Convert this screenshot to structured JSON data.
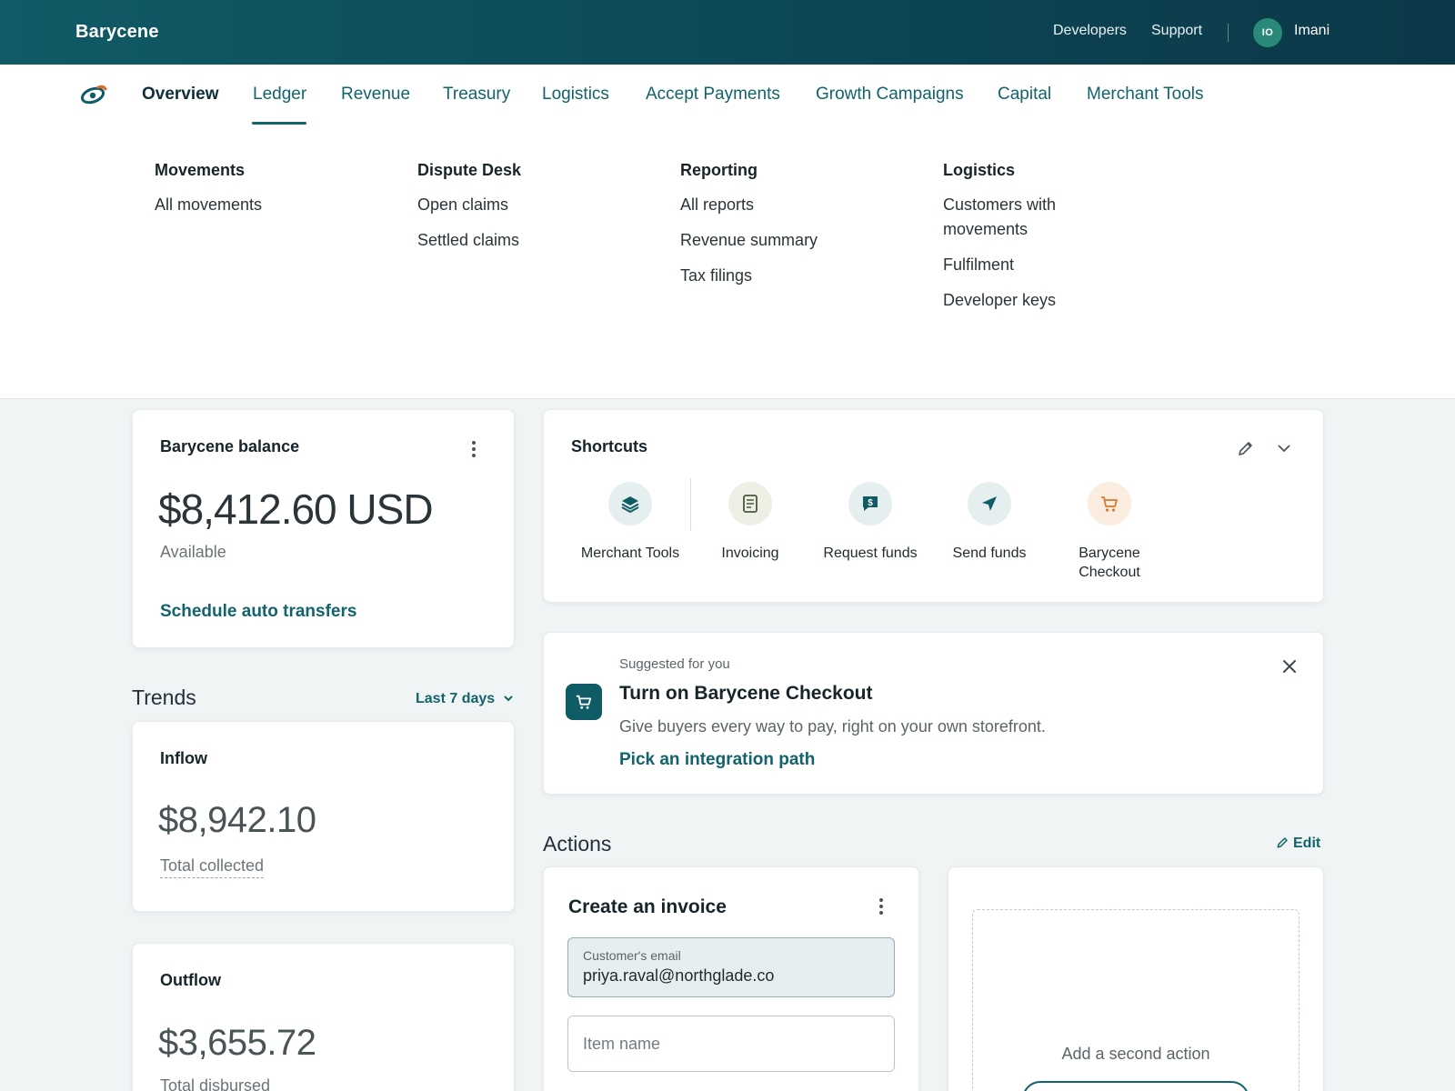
{
  "topbar": {
    "brand": "Barycene",
    "links": [
      "Developers",
      "Support"
    ],
    "avatar_initials": "IO",
    "user_name": "Imani"
  },
  "nav": {
    "tabs": [
      "Overview",
      "Ledger",
      "Revenue",
      "Treasury",
      "Logistics",
      "Accept Payments",
      "Growth Campaigns",
      "Capital",
      "Merchant Tools"
    ],
    "active": "Ledger"
  },
  "mega_menu": {
    "columns": [
      {
        "heading": "Movements",
        "items": [
          "All movements"
        ]
      },
      {
        "heading": "Dispute Desk",
        "items": [
          "Open claims",
          "Settled claims"
        ]
      },
      {
        "heading": "Reporting",
        "items": [
          "All reports",
          "Revenue summary",
          "Tax filings"
        ]
      },
      {
        "heading": "Logistics",
        "items": [
          "Customers with movements",
          "Fulfilment",
          "Developer keys"
        ]
      }
    ]
  },
  "balance": {
    "title": "Barycene balance",
    "amount": "$8,412.60 USD",
    "status": "Available",
    "cta": "Schedule auto transfers"
  },
  "trends": {
    "title": "Trends",
    "range": "Last 7 days",
    "inflow": {
      "title": "Inflow",
      "amount": "$8,942.10",
      "caption": "Total collected"
    },
    "outflow": {
      "title": "Outflow",
      "amount": "$3,655.72",
      "caption": "Total disbursed"
    }
  },
  "shortcuts": {
    "title": "Shortcuts",
    "items": [
      {
        "label": "Merchant Tools",
        "icon": "layers-icon"
      },
      {
        "label": "Invoicing",
        "icon": "document-icon"
      },
      {
        "label": "Request funds",
        "icon": "money-request-icon"
      },
      {
        "label": "Send funds",
        "icon": "paper-plane-icon"
      },
      {
        "label": "Barycene Checkout",
        "icon": "cart-icon"
      }
    ]
  },
  "suggestion": {
    "eyebrow": "Suggested for you",
    "title": "Turn on Barycene Checkout",
    "body": "Give buyers every way to pay, right on your own storefront.",
    "cta": "Pick an integration path"
  },
  "actions": {
    "title": "Actions",
    "edit": "Edit",
    "invoice": {
      "title": "Create an invoice",
      "email_label": "Customer's email",
      "email_value": "priya.raval@northglade.co",
      "item_placeholder": "Item name"
    },
    "second_action": "Add a second action"
  },
  "colors": {
    "brand_dark": "#0d4756",
    "accent": "#12636b",
    "checkout_orange": "#d97a2b"
  }
}
